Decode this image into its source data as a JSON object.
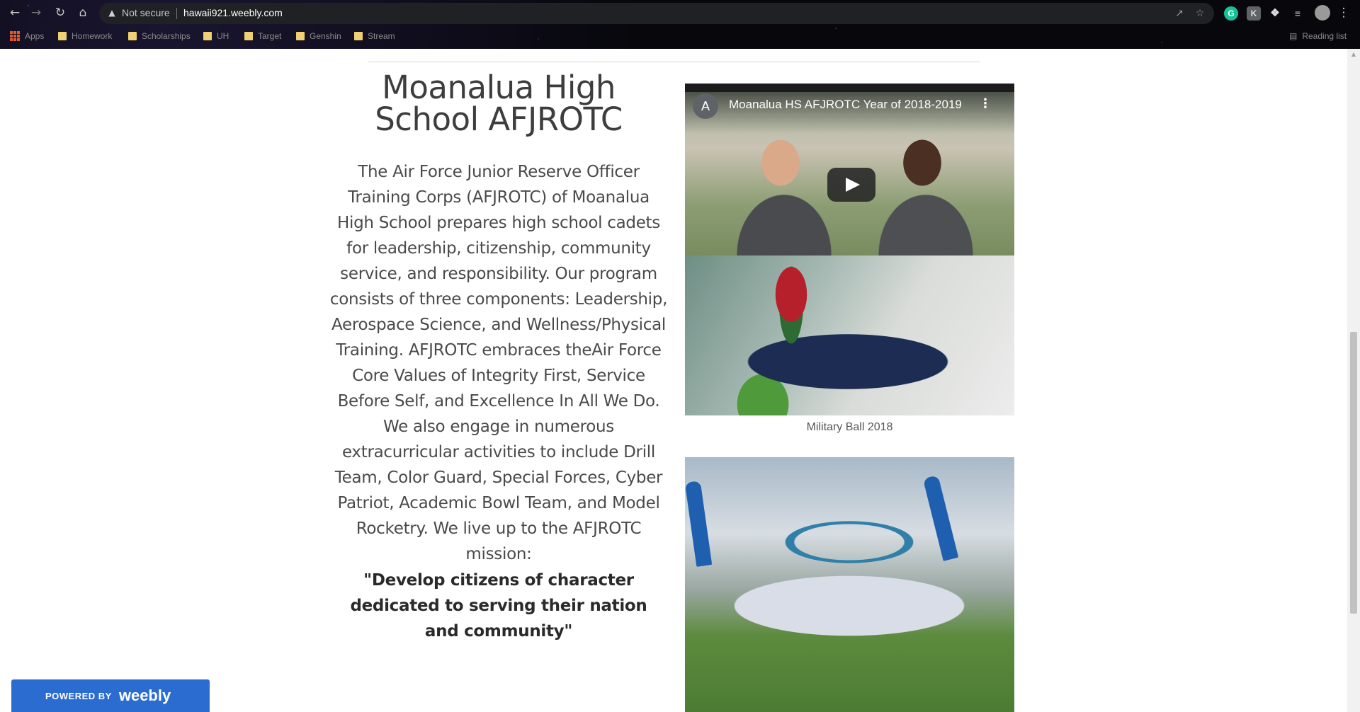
{
  "browser": {
    "security_label": "Not secure",
    "url": "hawaii921.weebly.com",
    "icons": {
      "back": "back-arrow-icon",
      "forward": "forward-arrow-icon",
      "reload": "reload-icon",
      "home": "home-icon",
      "warning": "warning-triangle-icon",
      "share": "share-icon",
      "star": "star-icon",
      "extensions": "puzzle-icon",
      "reading": "reading-list-icon",
      "profile": "profile-avatar-icon"
    },
    "bookmarks": [
      {
        "label": "Apps"
      },
      {
        "label": "Homework"
      },
      {
        "label": "Scholarships"
      },
      {
        "label": "UH"
      },
      {
        "label": "Target"
      },
      {
        "label": "Genshin"
      },
      {
        "label": "Stream"
      }
    ],
    "reading_list_label": "Reading list"
  },
  "main": {
    "title": "Moanalua High School AFJROTC",
    "description": "The Air Force Junior Reserve Officer Training Corps (AFJROTC) of Moanalua High School prepares high school cadets for leadership, citizenship, community service, and responsibility. Our program consists of three components: Leadership, Aerospace Science, and Wellness/Physical Training. AFJROTC embraces theAir Force Core Values of Integrity First, Service Before Self, and Excellence In All We Do. We also engage in numerous extracurricular activities to include Drill Team, Color Guard, Special Forces, Cyber Patriot, Academic Bowl Team, and Model Rocketry. We live up to the AFJROTC mission:",
    "mission": "\"Develop citizens of character dedicated to serving their nation and community\""
  },
  "video": {
    "channel_initial": "A",
    "title": "Moanalua HS AFJROTC Year of 2018-2019"
  },
  "gallery": {
    "caption_1": "Military Ball 2018"
  },
  "footer_badge": {
    "powered_by": "POWERED BY",
    "brand": "weebly"
  },
  "colors": {
    "badge_blue": "#2b6cd0",
    "text_gray": "#4a4a4a"
  }
}
